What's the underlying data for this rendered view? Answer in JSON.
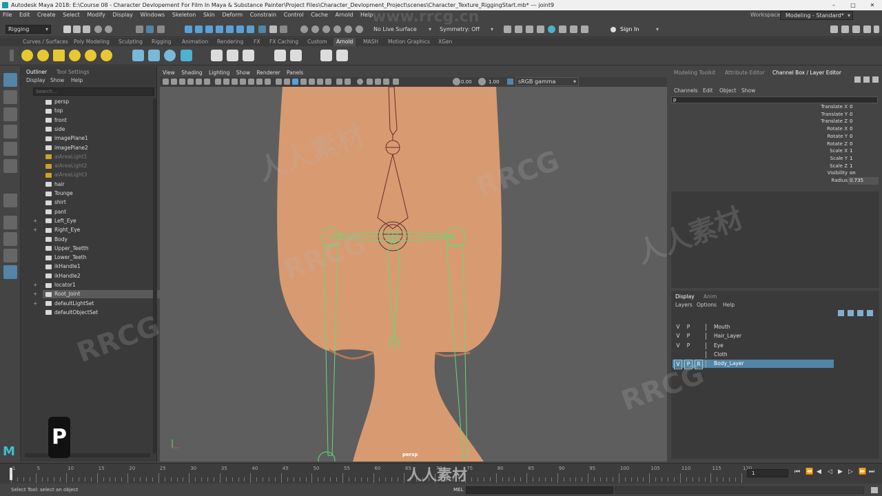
{
  "window": {
    "title": "Autodesk Maya 2018: E:\\Course 08 - Character Devlopement For Film In Maya & Substance Painter\\Project Files\\Character_Devlopment_Project\\scenes\\Character_Texture_RiggingStart.mb*  ---  joint9",
    "controls": [
      "–",
      "□",
      "✕"
    ]
  },
  "menu": [
    "File",
    "Edit",
    "Create",
    "Select",
    "Modify",
    "Display",
    "Windows",
    "Skeleton",
    "Skin",
    "Deform",
    "Constrain",
    "Control",
    "Cache",
    "Arnold",
    "Help"
  ],
  "workspace": {
    "label": "Workspace :",
    "value": "Modeling - Standard*"
  },
  "toolbar": {
    "mode": "Rigging",
    "live_surface": "No Live Surface",
    "symmetry": "Symmetry: Off",
    "sign_in": "Sign In"
  },
  "shelf_tabs": [
    "Curves / Surfaces",
    "Poly Modeling",
    "Sculpting",
    "Rigging",
    "Animation",
    "Rendering",
    "FX",
    "FX Caching",
    "Custom",
    "Arnold",
    "MASH",
    "Motion Graphics",
    "XGen"
  ],
  "shelf_active": "Arnold",
  "outliner": {
    "tabs": [
      "Outliner",
      "Tool Settings"
    ],
    "menu": [
      "Display",
      "Show",
      "Help"
    ],
    "search_placeholder": "Search...",
    "items": [
      {
        "label": "persp",
        "state": "normal",
        "expand": ""
      },
      {
        "label": "top",
        "state": "normal",
        "expand": ""
      },
      {
        "label": "front",
        "state": "normal",
        "expand": ""
      },
      {
        "label": "side",
        "state": "normal",
        "expand": ""
      },
      {
        "label": "imagePlane1",
        "state": "normal",
        "expand": ""
      },
      {
        "label": "imagePlane2",
        "state": "normal",
        "expand": ""
      },
      {
        "label": "aiAreaLight1",
        "state": "dim",
        "expand": ""
      },
      {
        "label": "aiAreaLight2",
        "state": "dim",
        "expand": ""
      },
      {
        "label": "aiAreaLight3",
        "state": "dim",
        "expand": ""
      },
      {
        "label": "hair",
        "state": "normal",
        "expand": ""
      },
      {
        "label": "Tounge",
        "state": "normal",
        "expand": ""
      },
      {
        "label": "shirt",
        "state": "normal",
        "expand": ""
      },
      {
        "label": "pant",
        "state": "normal",
        "expand": ""
      },
      {
        "label": "Left_Eye",
        "state": "normal",
        "expand": "+"
      },
      {
        "label": "Right_Eye",
        "state": "normal",
        "expand": "+"
      },
      {
        "label": "Body",
        "state": "normal",
        "expand": ""
      },
      {
        "label": "Upper_Teetth",
        "state": "normal",
        "expand": ""
      },
      {
        "label": "Lower_Teeth",
        "state": "normal",
        "expand": ""
      },
      {
        "label": "ikHandle1",
        "state": "normal",
        "expand": ""
      },
      {
        "label": "ikHandle2",
        "state": "normal",
        "expand": ""
      },
      {
        "label": "locator1",
        "state": "normal",
        "expand": "+"
      },
      {
        "label": "Root_Joint",
        "state": "selected",
        "expand": "+"
      },
      {
        "label": "defaultLightSet",
        "state": "normal",
        "expand": "+"
      },
      {
        "label": "defaultObjectSet",
        "state": "normal",
        "expand": ""
      }
    ]
  },
  "viewport": {
    "menu": [
      "View",
      "Shading",
      "Lighting",
      "Show",
      "Renderer",
      "Panels"
    ],
    "exposure": "0.00",
    "gamma": "1.00",
    "color_space": "sRGB gamma",
    "camera": "persp"
  },
  "right_panel": {
    "tabs": [
      "Modeling Toolkit",
      "Attribute Editor",
      "Channel Box / Layer Editor"
    ],
    "active_tab": "Channel Box / Layer Editor",
    "channel_menu": [
      "Channels",
      "Edit",
      "Object",
      "Show"
    ],
    "node_name": "p",
    "channels": [
      {
        "label": "Translate X",
        "value": "0"
      },
      {
        "label": "Translate Y",
        "value": "0"
      },
      {
        "label": "Translate Z",
        "value": "0"
      },
      {
        "label": "Rotate X",
        "value": "0"
      },
      {
        "label": "Rotate Y",
        "value": "0"
      },
      {
        "label": "Rotate Z",
        "value": "0"
      },
      {
        "label": "Scale X",
        "value": "1"
      },
      {
        "label": "Scale Y",
        "value": "1"
      },
      {
        "label": "Scale Z",
        "value": "1"
      },
      {
        "label": "Visibility",
        "value": "on"
      },
      {
        "label": "Radius",
        "value": "0.735"
      }
    ],
    "layer_tabs": [
      "Display",
      "Anim"
    ],
    "layer_menu": [
      "Layers",
      "Options",
      "Help"
    ],
    "layers": [
      {
        "v": "V",
        "p": "P",
        "r": "",
        "name": "Mouth",
        "selected": false
      },
      {
        "v": "V",
        "p": "P",
        "r": "",
        "name": "Hair_Layer",
        "selected": false
      },
      {
        "v": "V",
        "p": "P",
        "r": "",
        "name": "Eye",
        "selected": false
      },
      {
        "v": "",
        "p": "",
        "r": "",
        "name": "Cloth",
        "selected": false
      },
      {
        "v": "V",
        "p": "P",
        "r": "R",
        "name": "Body_Layer",
        "selected": true
      }
    ]
  },
  "timeline": {
    "ticks": [
      "1",
      "5",
      "10",
      "15",
      "20",
      "25",
      "30",
      "35",
      "40",
      "45",
      "50",
      "55",
      "60",
      "65",
      "70",
      "75",
      "80",
      "85",
      "90",
      "95",
      "100",
      "105",
      "110",
      "115",
      "120"
    ],
    "current_frame": "1",
    "current_frame_indicator": "1"
  },
  "status": {
    "help_line": "Select Tool: select an object",
    "command_lang": "MEL"
  },
  "overlay": {
    "letter": "P",
    "watermark_url": "www.rrcg.cn",
    "watermark_brand": "RRCG",
    "watermark_cn": "人人素材"
  },
  "colors": {
    "accent": "#5285a6",
    "joint_green": "#5fdc7a",
    "skin": "#d99a72",
    "joint_maroon": "#6b2830"
  }
}
